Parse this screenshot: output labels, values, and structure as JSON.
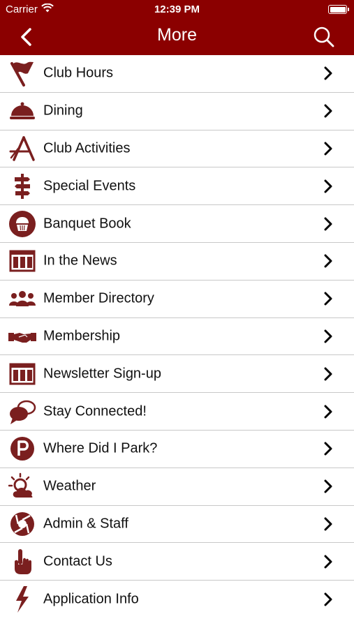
{
  "status_bar": {
    "carrier": "Carrier",
    "time": "12:39 PM"
  },
  "nav": {
    "title": "More"
  },
  "colors": {
    "brand": "#8b0000",
    "icon": "#7a1f1f",
    "divider": "#c8c8c8"
  },
  "menu": {
    "items": [
      {
        "label": "Club Hours",
        "icon": "flag-icon"
      },
      {
        "label": "Dining",
        "icon": "cloche-icon"
      },
      {
        "label": "Club Activities",
        "icon": "activities-icon"
      },
      {
        "label": "Special Events",
        "icon": "signpost-icon"
      },
      {
        "label": "Banquet Book",
        "icon": "cupcake-icon"
      },
      {
        "label": "In the News",
        "icon": "newspaper-icon"
      },
      {
        "label": "Member Directory",
        "icon": "people-icon"
      },
      {
        "label": "Membership",
        "icon": "handshake-icon"
      },
      {
        "label": "Newsletter Sign-up",
        "icon": "newsletter-icon"
      },
      {
        "label": "Stay Connected!",
        "icon": "chat-bubbles-icon"
      },
      {
        "label": "Where Did I Park?",
        "icon": "parking-icon"
      },
      {
        "label": "Weather",
        "icon": "weather-icon"
      },
      {
        "label": "Admin & Staff",
        "icon": "aperture-icon"
      },
      {
        "label": "Contact Us",
        "icon": "pointing-hand-icon"
      },
      {
        "label": "Application Info",
        "icon": "lightning-icon"
      }
    ]
  }
}
